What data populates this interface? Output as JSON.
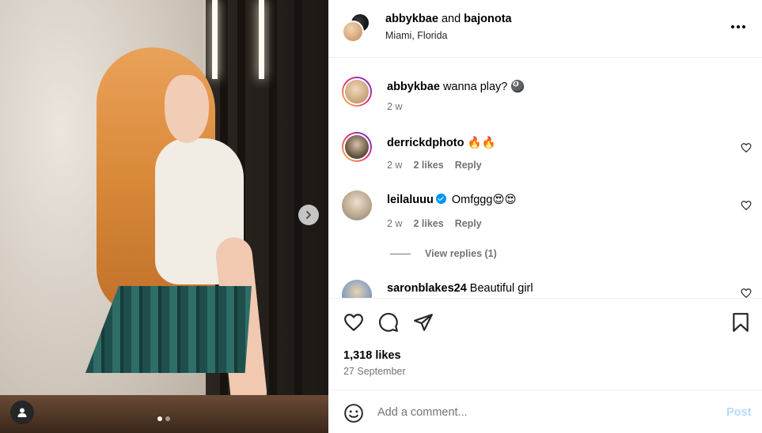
{
  "post": {
    "author": "abbykbae",
    "collaborator": "bajonota",
    "and_word": "and",
    "location": "Miami, Florida",
    "likes_text": "1,318 likes",
    "date": "27 September"
  },
  "caption": {
    "user": "abbykbae",
    "text": "wanna play? 🎱",
    "time": "2 w"
  },
  "comments": [
    {
      "user": "derrickdphoto",
      "text": "🔥🔥",
      "time": "2 w",
      "likes": "2 likes",
      "reply": "Reply"
    },
    {
      "user": "leilaluuu",
      "verified": true,
      "text": "Omfggg😍😍",
      "time": "2 w",
      "likes": "2 likes",
      "reply": "Reply",
      "view_replies": "View replies (1)"
    },
    {
      "user": "saronblakes24",
      "text": "Beautiful girl"
    }
  ],
  "add_comment": {
    "placeholder": "Add a comment...",
    "post_label": "Post"
  },
  "media": {
    "slide_count": 2,
    "active_slide": 1
  },
  "colors": {
    "link_blue": "#0095f6",
    "post_disabled": "#b3dbff",
    "secondary_text": "#737373"
  },
  "icons": [
    "chevron-right-icon",
    "user-tag-icon",
    "more-icon",
    "heart-icon",
    "comment-icon",
    "share-icon",
    "bookmark-icon",
    "emoji-icon",
    "verified-icon"
  ]
}
